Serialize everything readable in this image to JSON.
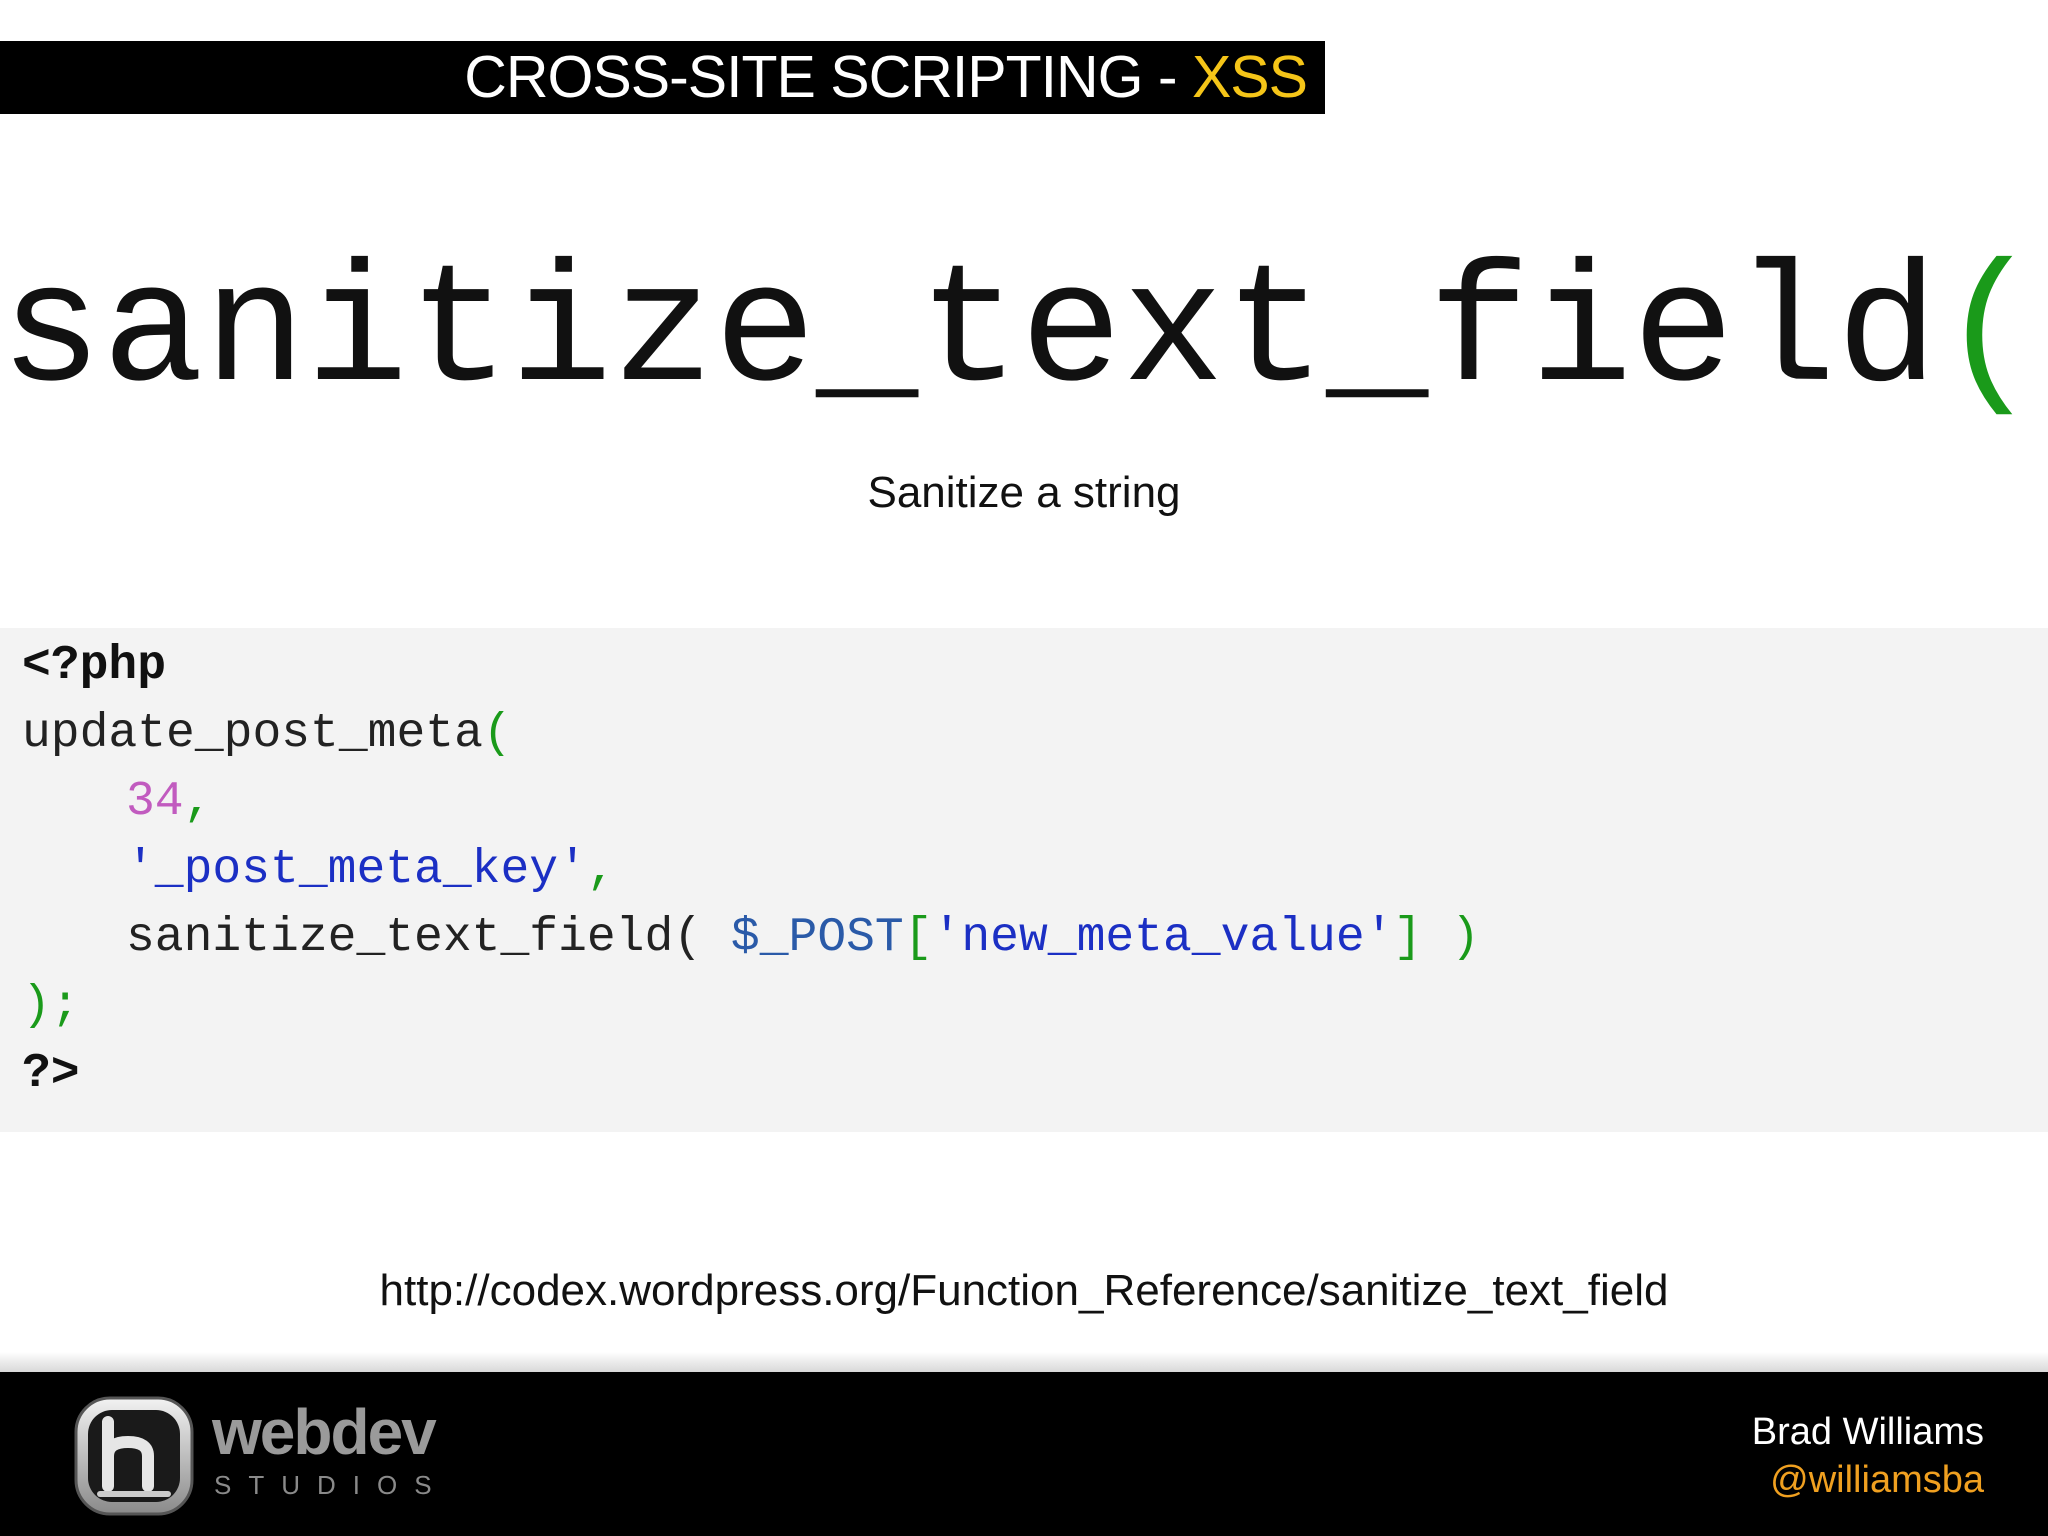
{
  "header": {
    "title_main": "CROSS-SITE SCRIPTING - ",
    "title_accent": "XSS"
  },
  "heading": {
    "function_name": "sanitize_text_field",
    "parens": "()"
  },
  "subtitle": "Sanitize a string",
  "code": {
    "open_tag": "<?php",
    "func_call": "update_post_meta",
    "open_paren": "(",
    "arg1_value": "34",
    "comma": ",",
    "arg2_value": "'_post_meta_key'",
    "arg3_func": "sanitize_text_field( ",
    "arg3_var": "$_POST",
    "arg3_bracket_open": "[",
    "arg3_key": "'new_meta_value'",
    "arg3_bracket_close": "]",
    "arg3_close": " )",
    "close_call": ");",
    "close_tag": "?>"
  },
  "reference_url": "http://codex.wordpress.org/Function_Reference/sanitize_text_field",
  "footer": {
    "logo_word": "webdev",
    "logo_sub": "STUDIOS",
    "author_name": "Brad Williams",
    "author_handle": "@williamsba"
  },
  "colors": {
    "title_accent": "#f5c518",
    "paren_green": "#1a9a1a",
    "number_pink": "#c15bbf",
    "string_blue": "#1b2fc4",
    "handle_orange": "#f0a020"
  }
}
